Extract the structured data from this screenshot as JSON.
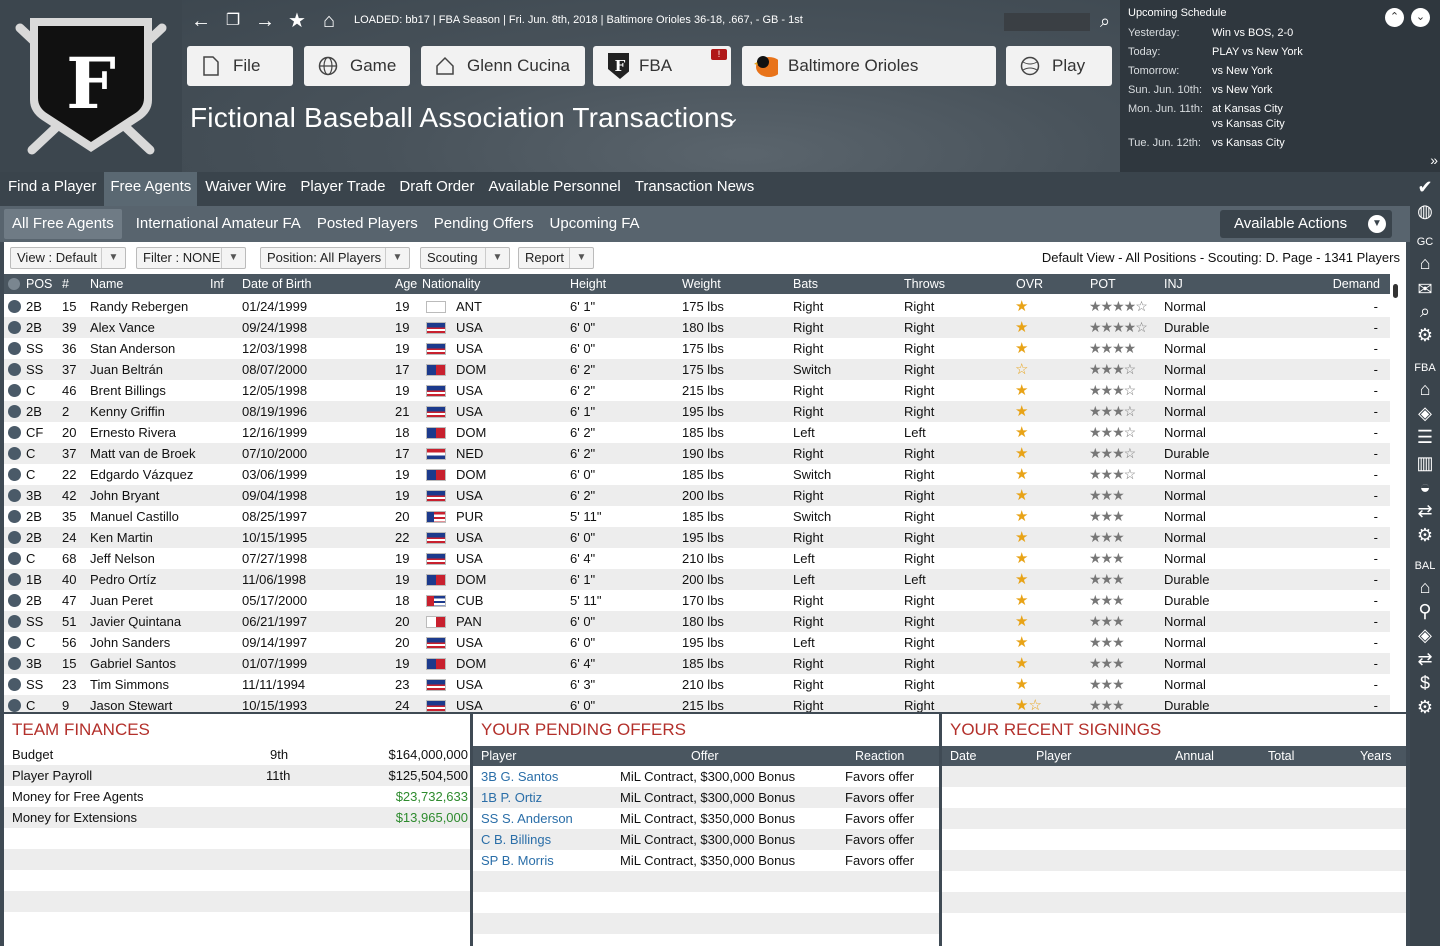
{
  "header": {
    "loaded_text": "LOADED: bb17  |  FBA Season  |  Fri. Jun. 8th, 2018  |  Baltimore Orioles   36-18, .667, - GB - 1st",
    "page_title": "Fictional Baseball Association Transactions",
    "buttons": {
      "file": "File",
      "game": "Game",
      "manager": "Glenn Cucina",
      "league": "FBA",
      "team": "Baltimore Orioles",
      "play": "Play"
    },
    "league_badge": "!",
    "logo_letter": "F"
  },
  "schedule": {
    "title": "Upcoming Schedule",
    "rows": [
      {
        "day": "Yesterday:",
        "game": "Win vs BOS, 2-0"
      },
      {
        "day": "Today:",
        "game": "PLAY vs New York"
      },
      {
        "day": "Tomorrow:",
        "game": "vs New York"
      },
      {
        "day": "Sun. Jun. 10th:",
        "game": "vs New York"
      },
      {
        "day": "Mon. Jun. 11th:",
        "game": "at Kansas City"
      },
      {
        "day": "",
        "game": "vs Kansas City"
      },
      {
        "day": "Tue. Jun. 12th:",
        "game": "vs Kansas City"
      }
    ]
  },
  "nav1": [
    "Find a Player",
    "Free Agents",
    "Waiver Wire",
    "Player Trade",
    "Draft Order",
    "Available Personnel",
    "Transaction News"
  ],
  "nav2": [
    "All Free Agents",
    "International Amateur FA",
    "Posted Players",
    "Pending Offers",
    "Upcoming FA"
  ],
  "available_actions": "Available Actions",
  "toolbar": {
    "view": "View : Default",
    "filter": "Filter : NONE",
    "position": "Position: All Players",
    "scouting": "Scouting",
    "report": "Report",
    "info": "Default View - All Positions - Scouting: D. Page - 1341 Players"
  },
  "columns": {
    "pos": "POS",
    "num": "#",
    "name": "Name",
    "inf": "Inf",
    "dob": "Date of Birth",
    "age": "Age",
    "nat": "Nationality",
    "height": "Height",
    "weight": "Weight",
    "bats": "Bats",
    "throws": "Throws",
    "ovr": "OVR",
    "pot": "POT",
    "inj": "INJ",
    "demand": "Demand"
  },
  "players": [
    {
      "pos": "2B",
      "num": "15",
      "name": "Randy Rebergen",
      "dob": "01/24/1999",
      "age": "19",
      "nat": "ANT",
      "height": "6' 1\"",
      "weight": "175 lbs",
      "bats": "Right",
      "throws": "Right",
      "ovr": "★",
      "pot": "★★★★☆",
      "inj": "Normal",
      "demand": "-"
    },
    {
      "pos": "2B",
      "num": "39",
      "name": "Alex Vance",
      "dob": "09/24/1998",
      "age": "19",
      "nat": "USA",
      "height": "6' 0\"",
      "weight": "180 lbs",
      "bats": "Right",
      "throws": "Right",
      "ovr": "★",
      "pot": "★★★★☆",
      "inj": "Durable",
      "demand": "-"
    },
    {
      "pos": "SS",
      "num": "36",
      "name": "Stan Anderson",
      "dob": "12/03/1998",
      "age": "19",
      "nat": "USA",
      "height": "6' 0\"",
      "weight": "175 lbs",
      "bats": "Right",
      "throws": "Right",
      "ovr": "★",
      "pot": "★★★★",
      "inj": "Normal",
      "demand": "-"
    },
    {
      "pos": "SS",
      "num": "37",
      "name": "Juan Beltrán",
      "dob": "08/07/2000",
      "age": "17",
      "nat": "DOM",
      "height": "6' 2\"",
      "weight": "175 lbs",
      "bats": "Switch",
      "throws": "Right",
      "ovr": "☆",
      "pot": "★★★☆",
      "inj": "Normal",
      "demand": "-"
    },
    {
      "pos": "C",
      "num": "46",
      "name": "Brent Billings",
      "dob": "12/05/1998",
      "age": "19",
      "nat": "USA",
      "height": "6' 2\"",
      "weight": "215 lbs",
      "bats": "Right",
      "throws": "Right",
      "ovr": "★",
      "pot": "★★★☆",
      "inj": "Normal",
      "demand": "-"
    },
    {
      "pos": "2B",
      "num": "2",
      "name": "Kenny Griffin",
      "dob": "08/19/1996",
      "age": "21",
      "nat": "USA",
      "height": "6' 1\"",
      "weight": "195 lbs",
      "bats": "Right",
      "throws": "Right",
      "ovr": "★",
      "pot": "★★★☆",
      "inj": "Normal",
      "demand": "-"
    },
    {
      "pos": "CF",
      "num": "20",
      "name": "Ernesto Rivera",
      "dob": "12/16/1999",
      "age": "18",
      "nat": "DOM",
      "height": "6' 2\"",
      "weight": "185 lbs",
      "bats": "Left",
      "throws": "Left",
      "ovr": "★",
      "pot": "★★★☆",
      "inj": "Normal",
      "demand": "-"
    },
    {
      "pos": "C",
      "num": "37",
      "name": "Matt van de Broek",
      "dob": "07/10/2000",
      "age": "17",
      "nat": "NED",
      "height": "6' 2\"",
      "weight": "190 lbs",
      "bats": "Right",
      "throws": "Right",
      "ovr": "★",
      "pot": "★★★☆",
      "inj": "Durable",
      "demand": "-"
    },
    {
      "pos": "C",
      "num": "22",
      "name": "Edgardo Vázquez",
      "dob": "03/06/1999",
      "age": "19",
      "nat": "DOM",
      "height": "6' 0\"",
      "weight": "185 lbs",
      "bats": "Switch",
      "throws": "Right",
      "ovr": "★",
      "pot": "★★★☆",
      "inj": "Normal",
      "demand": "-"
    },
    {
      "pos": "3B",
      "num": "42",
      "name": "John Bryant",
      "dob": "09/04/1998",
      "age": "19",
      "nat": "USA",
      "height": "6' 2\"",
      "weight": "200 lbs",
      "bats": "Right",
      "throws": "Right",
      "ovr": "★",
      "pot": "★★★",
      "inj": "Normal",
      "demand": "-"
    },
    {
      "pos": "2B",
      "num": "35",
      "name": "Manuel Castillo",
      "dob": "08/25/1997",
      "age": "20",
      "nat": "PUR",
      "height": "5' 11\"",
      "weight": "185 lbs",
      "bats": "Switch",
      "throws": "Right",
      "ovr": "★",
      "pot": "★★★",
      "inj": "Normal",
      "demand": "-"
    },
    {
      "pos": "2B",
      "num": "24",
      "name": "Ken Martin",
      "dob": "10/15/1995",
      "age": "22",
      "nat": "USA",
      "height": "6' 0\"",
      "weight": "195 lbs",
      "bats": "Right",
      "throws": "Right",
      "ovr": "★",
      "pot": "★★★",
      "inj": "Normal",
      "demand": "-"
    },
    {
      "pos": "C",
      "num": "68",
      "name": "Jeff Nelson",
      "dob": "07/27/1998",
      "age": "19",
      "nat": "USA",
      "height": "6' 4\"",
      "weight": "210 lbs",
      "bats": "Left",
      "throws": "Right",
      "ovr": "★",
      "pot": "★★★",
      "inj": "Normal",
      "demand": "-"
    },
    {
      "pos": "1B",
      "num": "40",
      "name": "Pedro Ortíz",
      "dob": "11/06/1998",
      "age": "19",
      "nat": "DOM",
      "height": "6' 1\"",
      "weight": "200 lbs",
      "bats": "Left",
      "throws": "Left",
      "ovr": "★",
      "pot": "★★★",
      "inj": "Durable",
      "demand": "-"
    },
    {
      "pos": "2B",
      "num": "47",
      "name": "Juan Peret",
      "dob": "05/17/2000",
      "age": "18",
      "nat": "CUB",
      "height": "5' 11\"",
      "weight": "170 lbs",
      "bats": "Right",
      "throws": "Right",
      "ovr": "★",
      "pot": "★★★",
      "inj": "Durable",
      "demand": "-"
    },
    {
      "pos": "SS",
      "num": "51",
      "name": "Javier Quintana",
      "dob": "06/21/1997",
      "age": "20",
      "nat": "PAN",
      "height": "6' 0\"",
      "weight": "180 lbs",
      "bats": "Right",
      "throws": "Right",
      "ovr": "★",
      "pot": "★★★",
      "inj": "Normal",
      "demand": "-"
    },
    {
      "pos": "C",
      "num": "56",
      "name": "John Sanders",
      "dob": "09/14/1997",
      "age": "20",
      "nat": "USA",
      "height": "6' 0\"",
      "weight": "195 lbs",
      "bats": "Left",
      "throws": "Right",
      "ovr": "★",
      "pot": "★★★",
      "inj": "Normal",
      "demand": "-"
    },
    {
      "pos": "3B",
      "num": "15",
      "name": "Gabriel Santos",
      "dob": "01/07/1999",
      "age": "19",
      "nat": "DOM",
      "height": "6' 4\"",
      "weight": "185 lbs",
      "bats": "Right",
      "throws": "Right",
      "ovr": "★",
      "pot": "★★★",
      "inj": "Normal",
      "demand": "-"
    },
    {
      "pos": "SS",
      "num": "23",
      "name": "Tim Simmons",
      "dob": "11/11/1994",
      "age": "23",
      "nat": "USA",
      "height": "6' 3\"",
      "weight": "210 lbs",
      "bats": "Right",
      "throws": "Right",
      "ovr": "★",
      "pot": "★★★",
      "inj": "Normal",
      "demand": "-"
    },
    {
      "pos": "C",
      "num": "9",
      "name": "Jason Stewart",
      "dob": "10/15/1993",
      "age": "24",
      "nat": "USA",
      "height": "6' 0\"",
      "weight": "215 lbs",
      "bats": "Right",
      "throws": "Right",
      "ovr": "★☆",
      "pot": "★★★",
      "inj": "Durable",
      "demand": "-"
    }
  ],
  "finances": {
    "title": "TEAM FINANCES",
    "rows": [
      {
        "label": "Budget",
        "rank": "9th",
        "value": "$164,000,000"
      },
      {
        "label": "Player Payroll",
        "rank": "11th",
        "value": "$125,504,500"
      },
      {
        "label": "Money for Free Agents",
        "rank": "",
        "value": "$23,732,633"
      },
      {
        "label": "Money for Extensions",
        "rank": "",
        "value": "$13,965,000"
      }
    ]
  },
  "pending": {
    "title": "YOUR PENDING OFFERS",
    "cols": {
      "player": "Player",
      "offer": "Offer",
      "reaction": "Reaction"
    },
    "rows": [
      {
        "player": "3B G. Santos",
        "offer": "MiL Contract, $300,000 Bonus",
        "reaction": "Favors offer"
      },
      {
        "player": "1B P. Ortiz",
        "offer": "MiL Contract, $300,000 Bonus",
        "reaction": "Favors offer"
      },
      {
        "player": "SS S. Anderson",
        "offer": "MiL Contract, $350,000 Bonus",
        "reaction": "Favors offer"
      },
      {
        "player": "C B. Billings",
        "offer": "MiL Contract, $300,000 Bonus",
        "reaction": "Favors offer"
      },
      {
        "player": "SP B. Morris",
        "offer": "MiL Contract, $350,000 Bonus",
        "reaction": "Favors offer"
      }
    ]
  },
  "signings": {
    "title": "YOUR RECENT SIGNINGS",
    "cols": {
      "date": "Date",
      "player": "Player",
      "annual": "Annual",
      "total": "Total",
      "years": "Years"
    }
  },
  "sidebar": {
    "gc": "GC",
    "fba": "FBA",
    "bal": "BAL"
  },
  "colors": {
    "header_bg": "#3a444c",
    "subnav_bg": "#58646e",
    "accent_red": "#b3302b",
    "star": "#e8a317",
    "link": "#2a6ea8",
    "positive": "#2e8b2e"
  }
}
